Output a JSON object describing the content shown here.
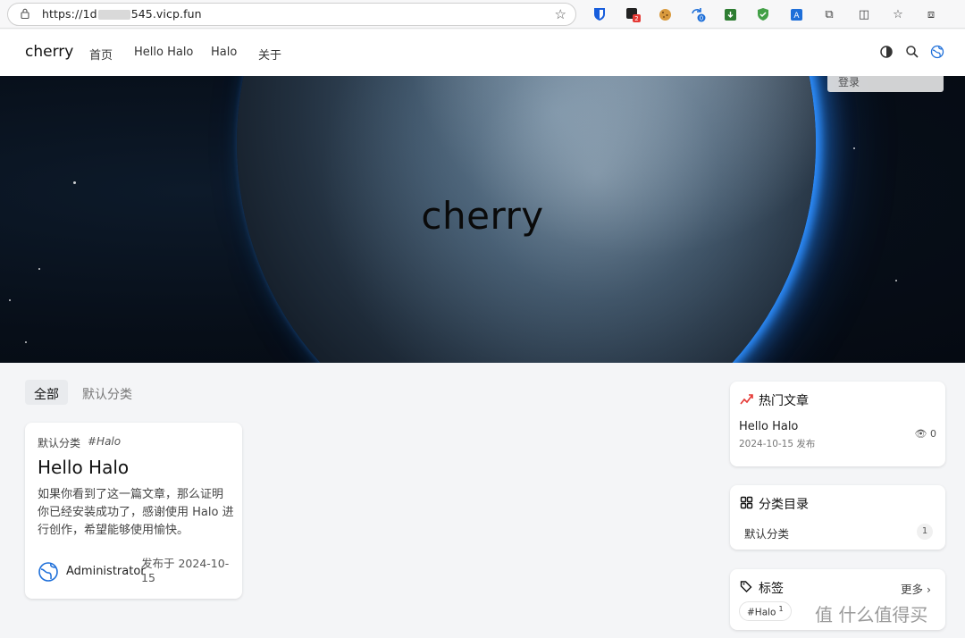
{
  "browser": {
    "url_prefix": "https://1d",
    "url_suffix": "545.vicp.fun",
    "ext_badge_red": "2",
    "ext_badge_blue": "0"
  },
  "header": {
    "brand": "cherry",
    "nav": [
      "首页",
      "Hello Halo",
      "Halo",
      "关于"
    ]
  },
  "hero": {
    "title": "cherry",
    "login_label": "登录"
  },
  "tabs": {
    "all": "全部",
    "default_category": "默认分类"
  },
  "post": {
    "category": "默认分类",
    "tag": "#Halo",
    "title": "Hello Halo",
    "excerpt": "如果你看到了这一篇文章，那么证明你已经安装成功了，感谢使用 Halo 进行创作，希望能够使用愉快。",
    "author": "Administrator",
    "date": "发布于 2024-10-15"
  },
  "sidebar": {
    "hot": {
      "title": "热门文章",
      "item_title": "Hello Halo",
      "item_date": "2024-10-15 发布",
      "views": "0"
    },
    "categories": {
      "title": "分类目录",
      "item_name": "默认分类",
      "item_count": "1"
    },
    "tags": {
      "title": "标签",
      "more": "更多",
      "chip": "#Halo",
      "chip_count": "1"
    }
  },
  "watermark": "值 什么值得买",
  "colors": {
    "accent": "#1e6fd9",
    "hot_icon": "#e53935",
    "planet_glow": "#2e8fff"
  }
}
